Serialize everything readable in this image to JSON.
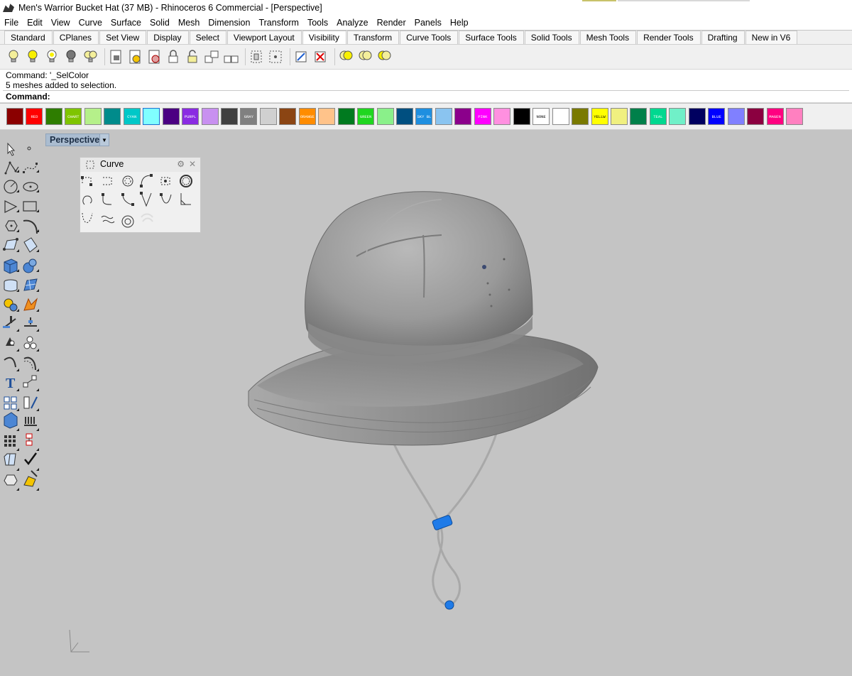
{
  "window": {
    "title": "Men's Warrior Bucket Hat (37 MB) - Rhinoceros 6 Commercial - [Perspective]",
    "app_icon": "rhino-icon"
  },
  "menu": [
    "File",
    "Edit",
    "View",
    "Curve",
    "Surface",
    "Solid",
    "Mesh",
    "Dimension",
    "Transform",
    "Tools",
    "Analyze",
    "Render",
    "Panels",
    "Help"
  ],
  "toolbar_tabs": [
    "Standard",
    "CPlanes",
    "Set View",
    "Display",
    "Select",
    "Viewport Layout",
    "Visibility",
    "Transform",
    "Curve Tools",
    "Surface Tools",
    "Solid Tools",
    "Mesh Tools",
    "Render Tools",
    "Drafting",
    "New in V6"
  ],
  "active_tab": "Visibility",
  "toolbar_icons": [
    "show-icon",
    "hide-icon",
    "show-selected-icon",
    "hide-swap-icon",
    "show-all-icon",
    "lock-icon",
    "lock-selected-icon",
    "unlock-selected-icon",
    "lock-closed-icon",
    "lock-open-icon",
    "lock-swap-icon",
    "unlock-icon",
    "select-points-icon",
    "hide-points-icon",
    "show-points-icon",
    "delete-points-icon",
    "bulb-left-icon",
    "bulb-mid-icon",
    "bulb-right-icon"
  ],
  "command": {
    "history_1": "Command: '_SelColor",
    "history_2": "5 meshes added to selection.",
    "prompt": "Command:"
  },
  "palette": [
    {
      "color": "#8b0000",
      "label": ""
    },
    {
      "color": "#ff0000",
      "label": "RED"
    },
    {
      "color": "#2e7d00",
      "label": ""
    },
    {
      "color": "#7fc400",
      "label": "CHART"
    },
    {
      "color": "#b5f08a",
      "label": ""
    },
    {
      "color": "#008b8b",
      "label": ""
    },
    {
      "color": "#00c8c8",
      "label": "CYAN"
    },
    {
      "color": "#80ffff",
      "label": ""
    },
    {
      "color": "#4b0082",
      "label": ""
    },
    {
      "color": "#8a2be2",
      "label": "PURPL"
    },
    {
      "color": "#c890f0",
      "label": ""
    },
    {
      "color": "#404040",
      "label": ""
    },
    {
      "color": "#808080",
      "label": "GRAY"
    },
    {
      "color": "#d0d0d0",
      "label": ""
    },
    {
      "color": "#8b4513",
      "label": ""
    },
    {
      "color": "#ff8c00",
      "label": "ORANGE"
    },
    {
      "color": "#ffc38a",
      "label": ""
    },
    {
      "color": "#007a1f",
      "label": ""
    },
    {
      "color": "#1fd61f",
      "label": "GREEN"
    },
    {
      "color": "#8af08a",
      "label": ""
    },
    {
      "color": "#004f80",
      "label": ""
    },
    {
      "color": "#1e8fe0",
      "label": "SKY BL"
    },
    {
      "color": "#8ac4f0",
      "label": ""
    },
    {
      "color": "#8b008b",
      "label": ""
    },
    {
      "color": "#ff00ff",
      "label": "PINK"
    },
    {
      "color": "#ff90e0",
      "label": ""
    },
    {
      "color": "#000000",
      "label": ""
    },
    {
      "color": "#ffffff",
      "label": "NONE"
    },
    {
      "color": "#ffffff",
      "label": ""
    },
    {
      "color": "#7a7a00",
      "label": ""
    },
    {
      "color": "#ffff00",
      "label": "YELLW"
    },
    {
      "color": "#f0f080",
      "label": ""
    },
    {
      "color": "#00804a",
      "label": ""
    },
    {
      "color": "#00d890",
      "label": "TEAL"
    },
    {
      "color": "#70f0c8",
      "label": ""
    },
    {
      "color": "#000060",
      "label": ""
    },
    {
      "color": "#0000ff",
      "label": "BLUE"
    },
    {
      "color": "#8080ff",
      "label": ""
    },
    {
      "color": "#8b0040",
      "label": ""
    },
    {
      "color": "#ff0080",
      "label": "MAGEN"
    },
    {
      "color": "#ff80c0",
      "label": ""
    }
  ],
  "left_toolbar": [
    "select-arrow-icon",
    "point-icon",
    "polyline-icon",
    "curve-icon",
    "circle-icon",
    "ellipse-icon",
    "arc-icon",
    "rectangle-icon",
    "polygon-icon",
    "freeform-curve-icon",
    "surface-corner-icon",
    "surface-extrude-icon",
    "box-icon",
    "sphere-icon",
    "cylinder-icon",
    "mesh-icon",
    "boolean-union-icon",
    "explode-icon",
    "split-icon",
    "trim-icon",
    "join-icon",
    "group-icon",
    "fillet-icon",
    "offset-icon",
    "text-icon",
    "dimension-icon",
    "array-icon",
    "move-icon",
    "surface-tools-icon",
    "drafting-icon",
    "grid-icon",
    "transform-icon",
    "analyze-icon",
    "checkmark-icon",
    "render-icon",
    "paint-icon"
  ],
  "viewport": {
    "name": "Perspective"
  },
  "curve_panel": {
    "title": "Curve",
    "icons": [
      "point-curve-icon",
      "polyline-icon",
      "circle-icon",
      "arc-icon",
      "rectangle-icon",
      "polygon-icon",
      "spiral-icon",
      "fillet-curve-icon",
      "blend-curve-icon",
      "parabola-icon",
      "hyperbola-icon",
      "chamfer-icon",
      "catenary-icon",
      "helix-icon",
      "offset-curve-icon",
      "conic-icon"
    ]
  },
  "colors": {
    "accent": "#aabcd0",
    "viewport_bg": "#c4c4c4",
    "hat": "#9a9a9a",
    "toggle": "#1f7be8"
  }
}
